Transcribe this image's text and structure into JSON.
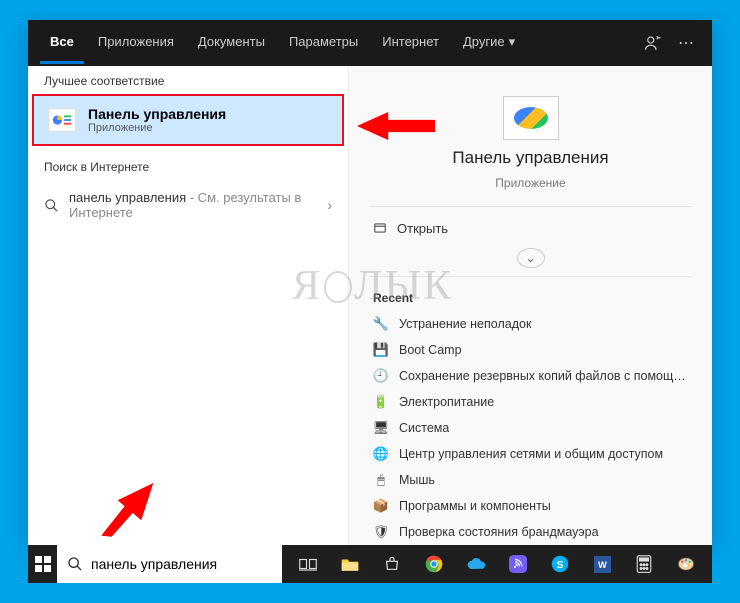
{
  "tabs": {
    "all": "Все",
    "apps": "Приложения",
    "documents": "Документы",
    "settings": "Параметры",
    "internet": "Интернет",
    "more": "Другие"
  },
  "left": {
    "best_header": "Лучшее соответствие",
    "best_title": "Панель управления",
    "best_sub": "Приложение",
    "web_header": "Поиск в Интернете",
    "web_query": "панель управления",
    "web_suffix": " - См. результаты в Интернете"
  },
  "right": {
    "title": "Панель управления",
    "sub": "Приложение",
    "open": "Открыть",
    "recent_header": "Recent",
    "recent": [
      {
        "icon": "🔧",
        "label": "Устранение неполадок"
      },
      {
        "icon": "💾",
        "label": "Boot Camp"
      },
      {
        "icon": "🕘",
        "label": "Сохранение резервных копий файлов с помощью ист..."
      },
      {
        "icon": "🔋",
        "label": "Электропитание"
      },
      {
        "icon": "🖥",
        "label": "Система"
      },
      {
        "icon": "🌐",
        "label": "Центр управления сетями и общим доступом"
      },
      {
        "icon": "🖱",
        "label": "Мышь"
      },
      {
        "icon": "📦",
        "label": "Программы и компоненты"
      },
      {
        "icon": "🛡",
        "label": "Проверка состояния брандмауэра"
      }
    ]
  },
  "search_value": "панель управления",
  "watermark": "ЯБЛЫК"
}
